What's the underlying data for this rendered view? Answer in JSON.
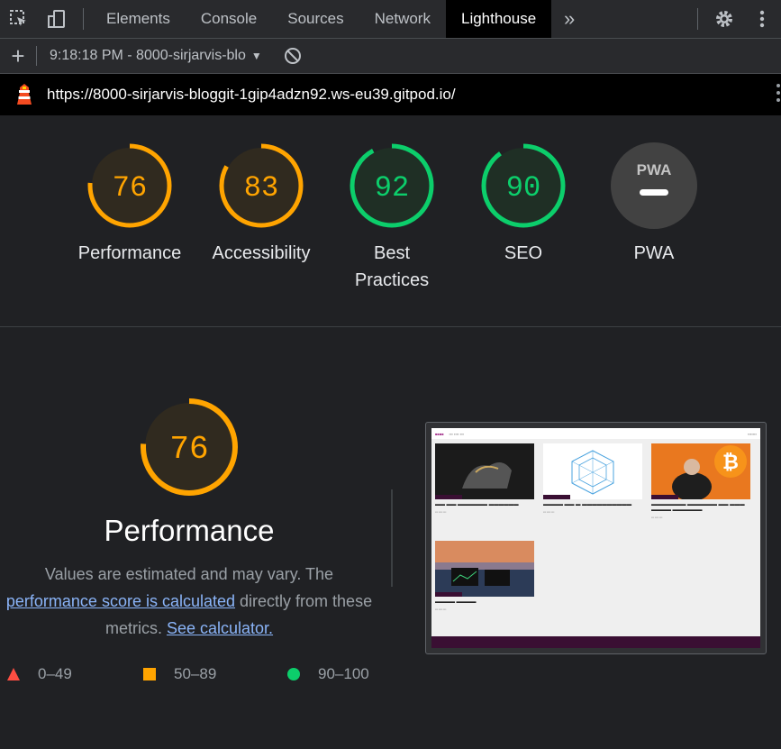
{
  "devtools": {
    "tabs": [
      "Elements",
      "Console",
      "Sources",
      "Network",
      "Lighthouse"
    ],
    "active_tab": "Lighthouse",
    "icons": [
      "inspect-element-icon",
      "device-toolbar-icon",
      "more-tabs-icon",
      "settings-gear-icon",
      "kebab-menu-icon"
    ]
  },
  "toolbar": {
    "report_label": "9:18:18 PM - 8000-sirjarvis-blo",
    "icons": [
      "add-icon",
      "caret-down-icon",
      "clear-block-icon"
    ]
  },
  "urlbar": {
    "url": "https://8000-sirjarvis-bloggit-1gip4adzn92.ws-eu39.gitpod.io/"
  },
  "gauges": [
    {
      "score": "76",
      "value": 0.76,
      "label_lines": [
        "Performance"
      ],
      "color": "#ffa400"
    },
    {
      "score": "83",
      "value": 0.83,
      "label_lines": [
        "Accessibility"
      ],
      "color": "#ffa400"
    },
    {
      "score": "92",
      "value": 0.92,
      "label_lines": [
        "Best",
        "Practices"
      ],
      "color": "#0cce6b"
    },
    {
      "score": "90",
      "value": 0.9,
      "label_lines": [
        "SEO"
      ],
      "color": "#0cce6b"
    },
    {
      "score": "PWA",
      "value": null,
      "label_lines": [
        "PWA"
      ],
      "color": "#9aa0a6"
    }
  ],
  "performance": {
    "score": "76",
    "value": 0.76,
    "title": "Performance",
    "desc_before": "Values are estimated and may vary. The",
    "desc_link": "performance score is calculated",
    "desc_middle": "directly from these metrics.",
    "desc_link2": "See calculator."
  },
  "legend": [
    {
      "range": "0–49",
      "shape": "triangle",
      "color": "#ff4e42"
    },
    {
      "range": "50–89",
      "shape": "square",
      "color": "#ffa400"
    },
    {
      "range": "90–100",
      "shape": "circle",
      "color": "#0cce6b"
    }
  ],
  "colors": {
    "background": "#202124",
    "pass": "#0cce6b",
    "average": "#ffa400",
    "fail": "#ff4e42",
    "link": "#8ab4f8"
  }
}
